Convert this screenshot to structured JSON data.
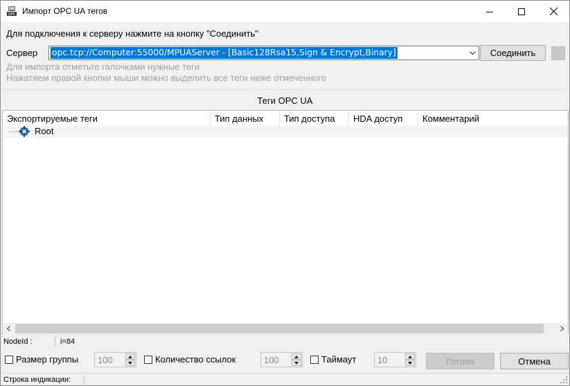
{
  "window": {
    "title": "Импорт OPC UA тегов",
    "icon_label": "OPC"
  },
  "header": {
    "instruction": "Для подключения к серверу нажмите на кнопку \"Соединить\"",
    "server_label": "Сервер",
    "server_value": "opc.tcp://Computer:55000/MPUAServer - [Basic128Rsa15,Sign & Encrypt,Binary]",
    "connect_button": "Соединить",
    "hint1": "Для импорта отметьте галочками нужные теги",
    "hint2": "Нажатием правой кнопки мыши можно выделить все теги ниже отмеченного"
  },
  "tags": {
    "section_title": "Теги OPC UA",
    "columns": [
      "Экспортируемые теги",
      "Тип данных",
      "Тип доступа",
      "HDA доступ",
      "Комментарий"
    ],
    "root_label": "Root"
  },
  "node": {
    "label": "NodeId :",
    "value": "i=84"
  },
  "options": {
    "group_size_label": "Размер группы",
    "group_size_value": "100",
    "ref_count_label": "Количество ссылок",
    "ref_count_value": "100",
    "timeout_label": "Таймаут",
    "timeout_value": "10",
    "ready_button": "Готово",
    "cancel_button": "Отмена"
  },
  "status": {
    "label": "Строка индикации:"
  },
  "colors": {
    "selection": "#0078d7",
    "window_bg": "#f0f0f0"
  }
}
